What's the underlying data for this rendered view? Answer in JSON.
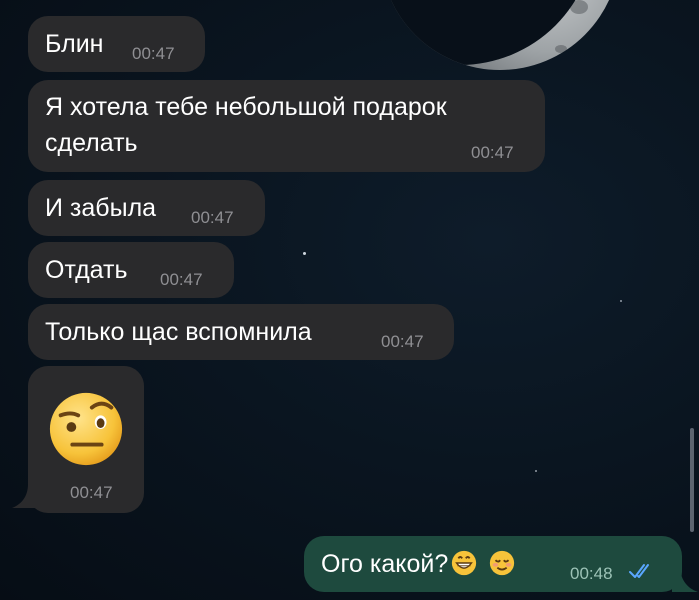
{
  "messages": [
    {
      "text": "Блин",
      "time": "00:47"
    },
    {
      "text_line1": "Я хотела тебе небольшой подарок",
      "text_line2": "сделать",
      "time": "00:47"
    },
    {
      "text": "И забыла",
      "time": "00:47"
    },
    {
      "text": "Отдать",
      "time": "00:47"
    },
    {
      "text": "Только щас вспомнила",
      "time": "00:47"
    },
    {
      "emoji": "face-with-raised-eyebrow",
      "time": "00:47"
    }
  ],
  "outgoing": {
    "text": "Ого какой?",
    "emojis": [
      "grinning-face",
      "smiling-face"
    ],
    "time": "00:48",
    "status": "read-double-check"
  },
  "colors": {
    "incoming_bubble": "#2a2a2c",
    "outgoing_bubble": "#1e4a3e",
    "check": "#5aa7ff"
  }
}
